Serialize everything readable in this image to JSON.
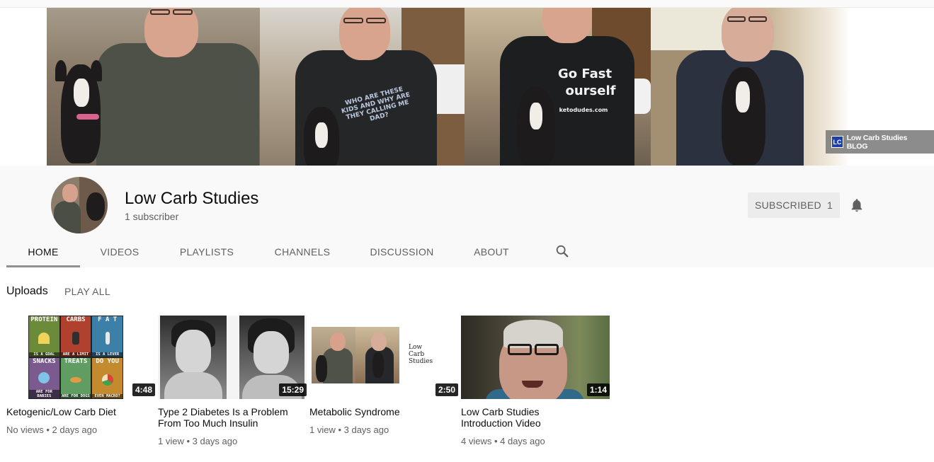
{
  "banner": {
    "shirt_text_1": "WHO ARE THESE KIDS AND WHY ARE THEY CALLING ME DAD?",
    "shirt_text_2": "Go Fast",
    "shirt_text_3": "ourself",
    "shirt_text_4": "ketodudes.com",
    "blog_logo": "LC",
    "blog_link_label": "Low Carb Studies BLOG"
  },
  "channel": {
    "title": "Low Carb Studies",
    "subscribers": "1 subscriber",
    "subscribe_label": "SUBSCRIBED",
    "subscribe_count": "1"
  },
  "tabs": [
    {
      "label": "HOME",
      "active": true
    },
    {
      "label": "VIDEOS"
    },
    {
      "label": "PLAYLISTS"
    },
    {
      "label": "CHANNELS"
    },
    {
      "label": "DISCUSSION"
    },
    {
      "label": "ABOUT"
    }
  ],
  "icons": {
    "bell": "bell-icon",
    "search": "search-icon"
  },
  "uploads": {
    "title": "Uploads",
    "play_all": "PLAY ALL",
    "videos": [
      {
        "title": "Ketogenic/Low Carb Diet",
        "duration": "4:48",
        "meta": "No views • 2 days ago",
        "poster": {
          "c1_top": "PROTEIN",
          "c1_bottom": "IS A GOAL",
          "c2_top": "CARBS",
          "c2_bottom": "ARE A LIMIT",
          "c3_top": "F A T",
          "c3_bottom": "IS A LEVER",
          "c4_top": "SNACKS",
          "c4_bottom": "ARE FOR BABIES",
          "c5_top": "TREATS",
          "c5_bottom": "ARE FOR DOGS",
          "c6_top": "DO YOU",
          "c6_bottom": "EVEN MACRO?"
        }
      },
      {
        "title": "Type 2 Diabetes Is a Problem From Too Much Insulin",
        "duration": "15:29",
        "meta": "1 view • 3 days ago"
      },
      {
        "title": "Metabolic Syndrome",
        "duration": "2:50",
        "meta": "1 view • 3 days ago",
        "thumb_text_1": "Low",
        "thumb_text_2": "Carb",
        "thumb_text_3": "Studies"
      },
      {
        "title": "Low Carb Studies Introduction Video",
        "duration": "1:14",
        "meta": "4 views • 4 days ago"
      }
    ]
  },
  "colors": {
    "header_bg": "#f9f9f9",
    "text_primary": "#0d0d0d",
    "text_secondary": "#606060",
    "subscribe_bg": "#ececec"
  }
}
